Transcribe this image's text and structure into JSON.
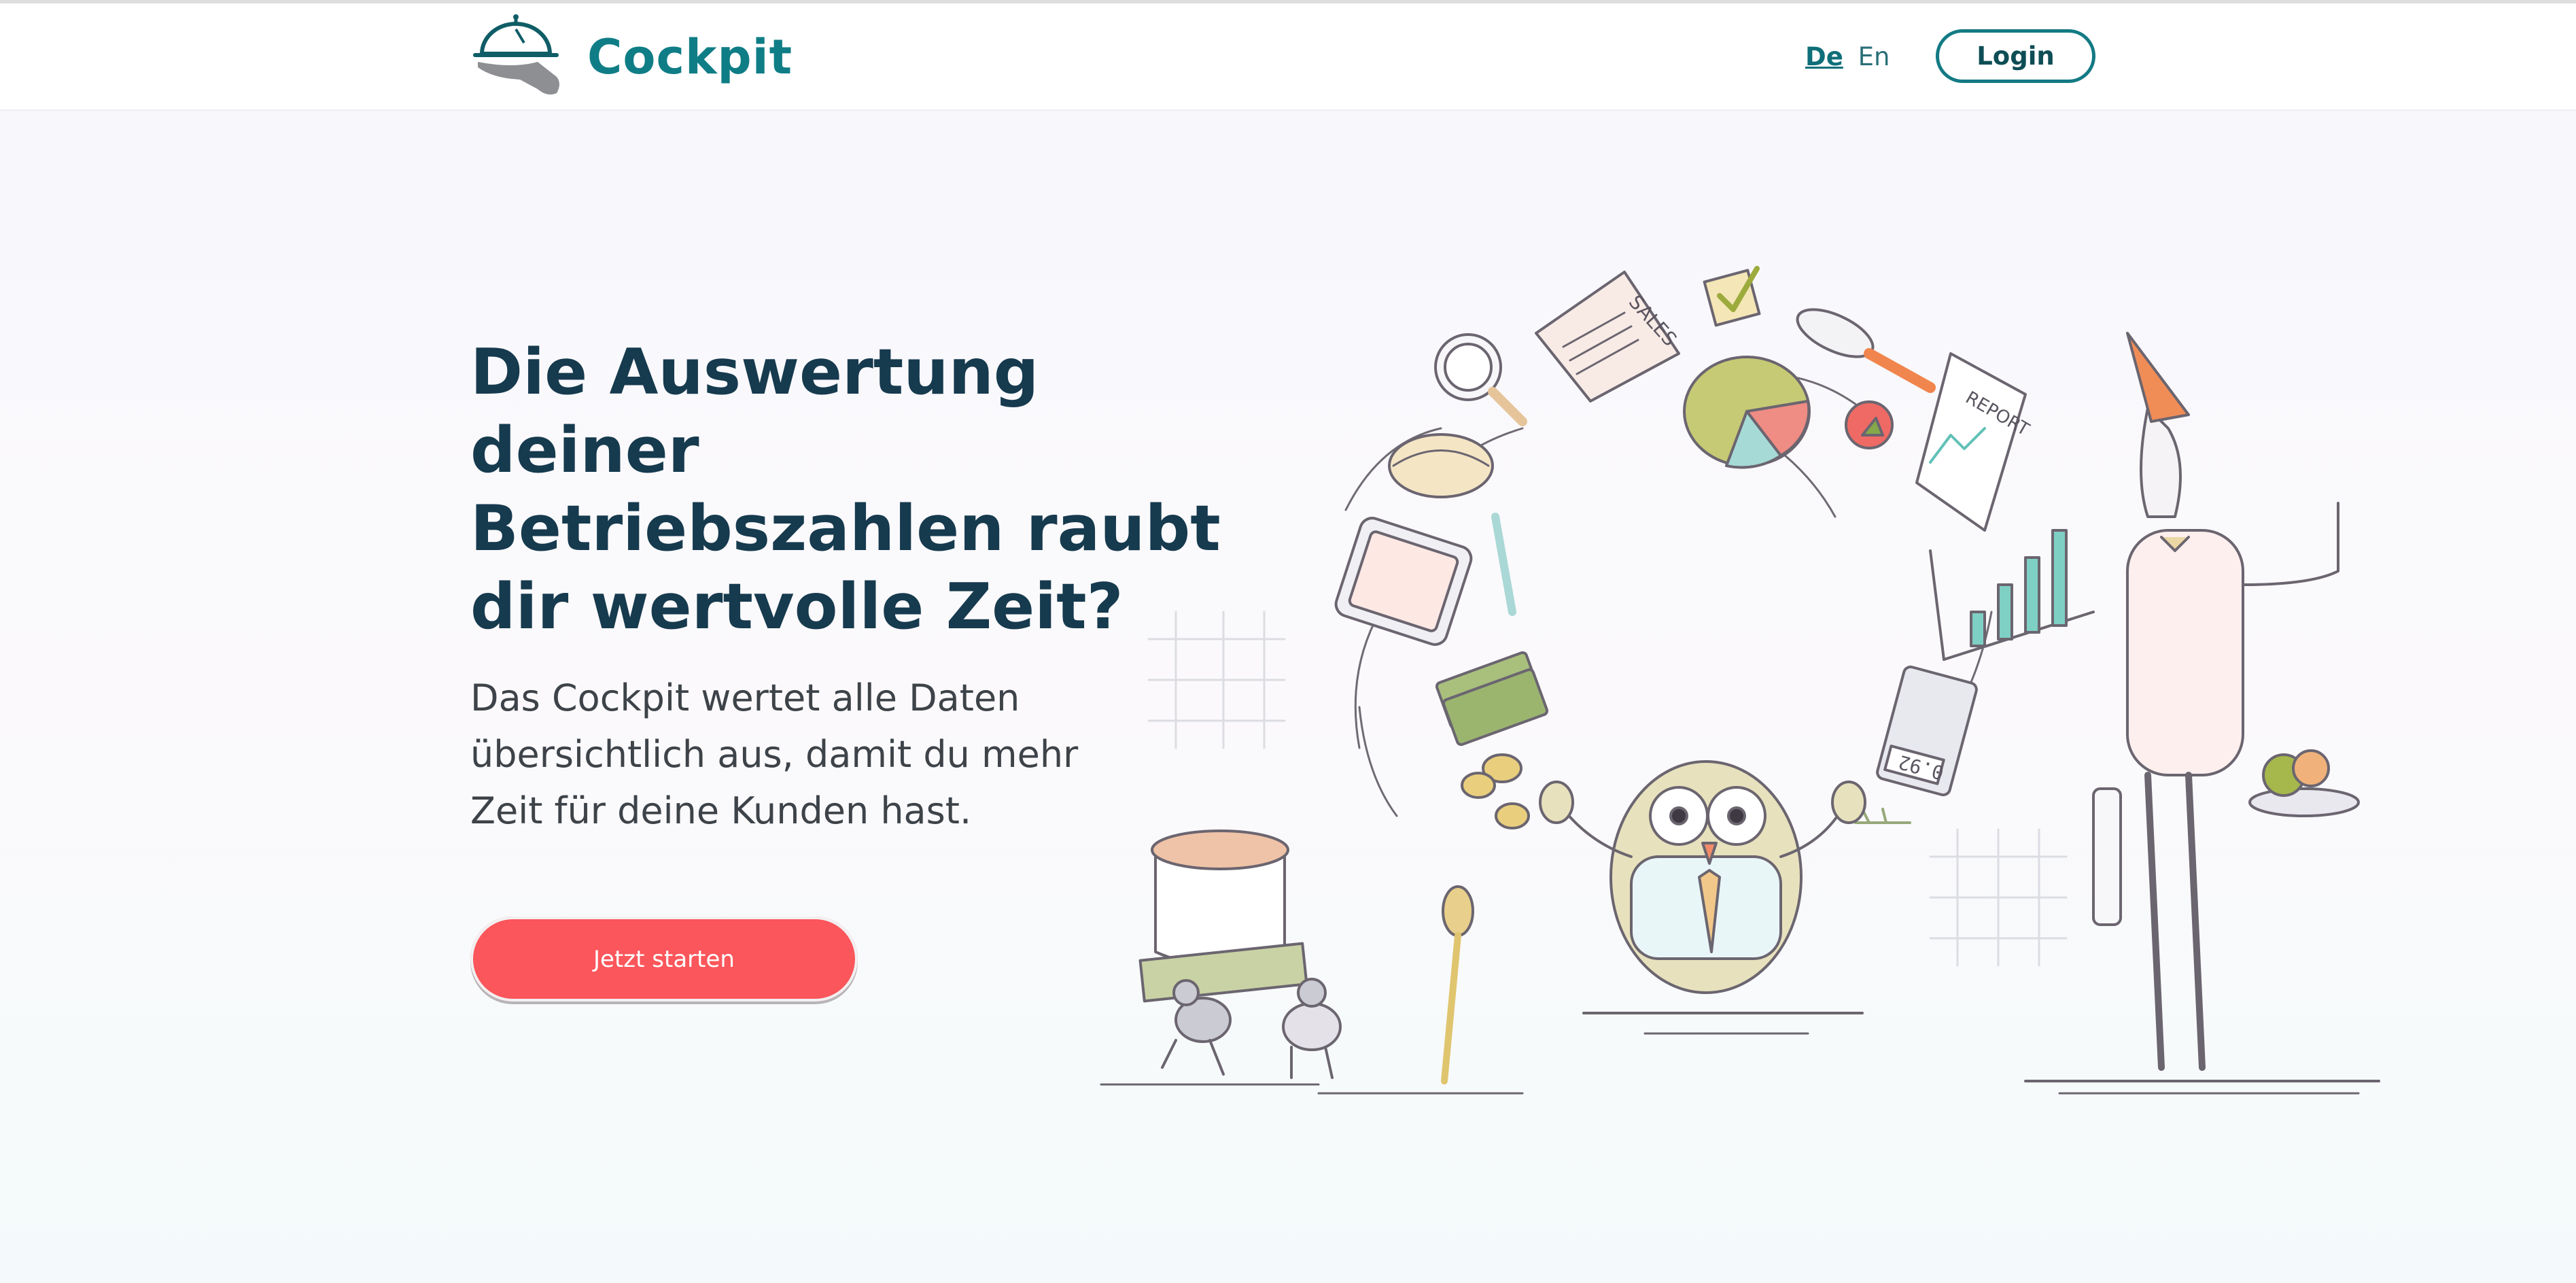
{
  "header": {
    "brand": "Cockpit",
    "lang_de": "De",
    "lang_en": "En",
    "login_label": "Login"
  },
  "hero": {
    "headline_lines": [
      "Die Auswertung deiner",
      "Betriebszahlen raubt",
      "dir wertvolle Zeit?"
    ],
    "sub_lines": [
      "Das Cockpit wertet alle Daten",
      "übersichtlich aus, damit du mehr",
      "Zeit für deine Kunden hast."
    ],
    "cta_label": "Jetzt starten"
  },
  "illustration": {
    "items": [
      "SALES",
      "REPORT",
      "0.92"
    ]
  },
  "colors": {
    "brand": "#0f7d86",
    "headline": "#163a4e",
    "cta": "#fb565b"
  }
}
